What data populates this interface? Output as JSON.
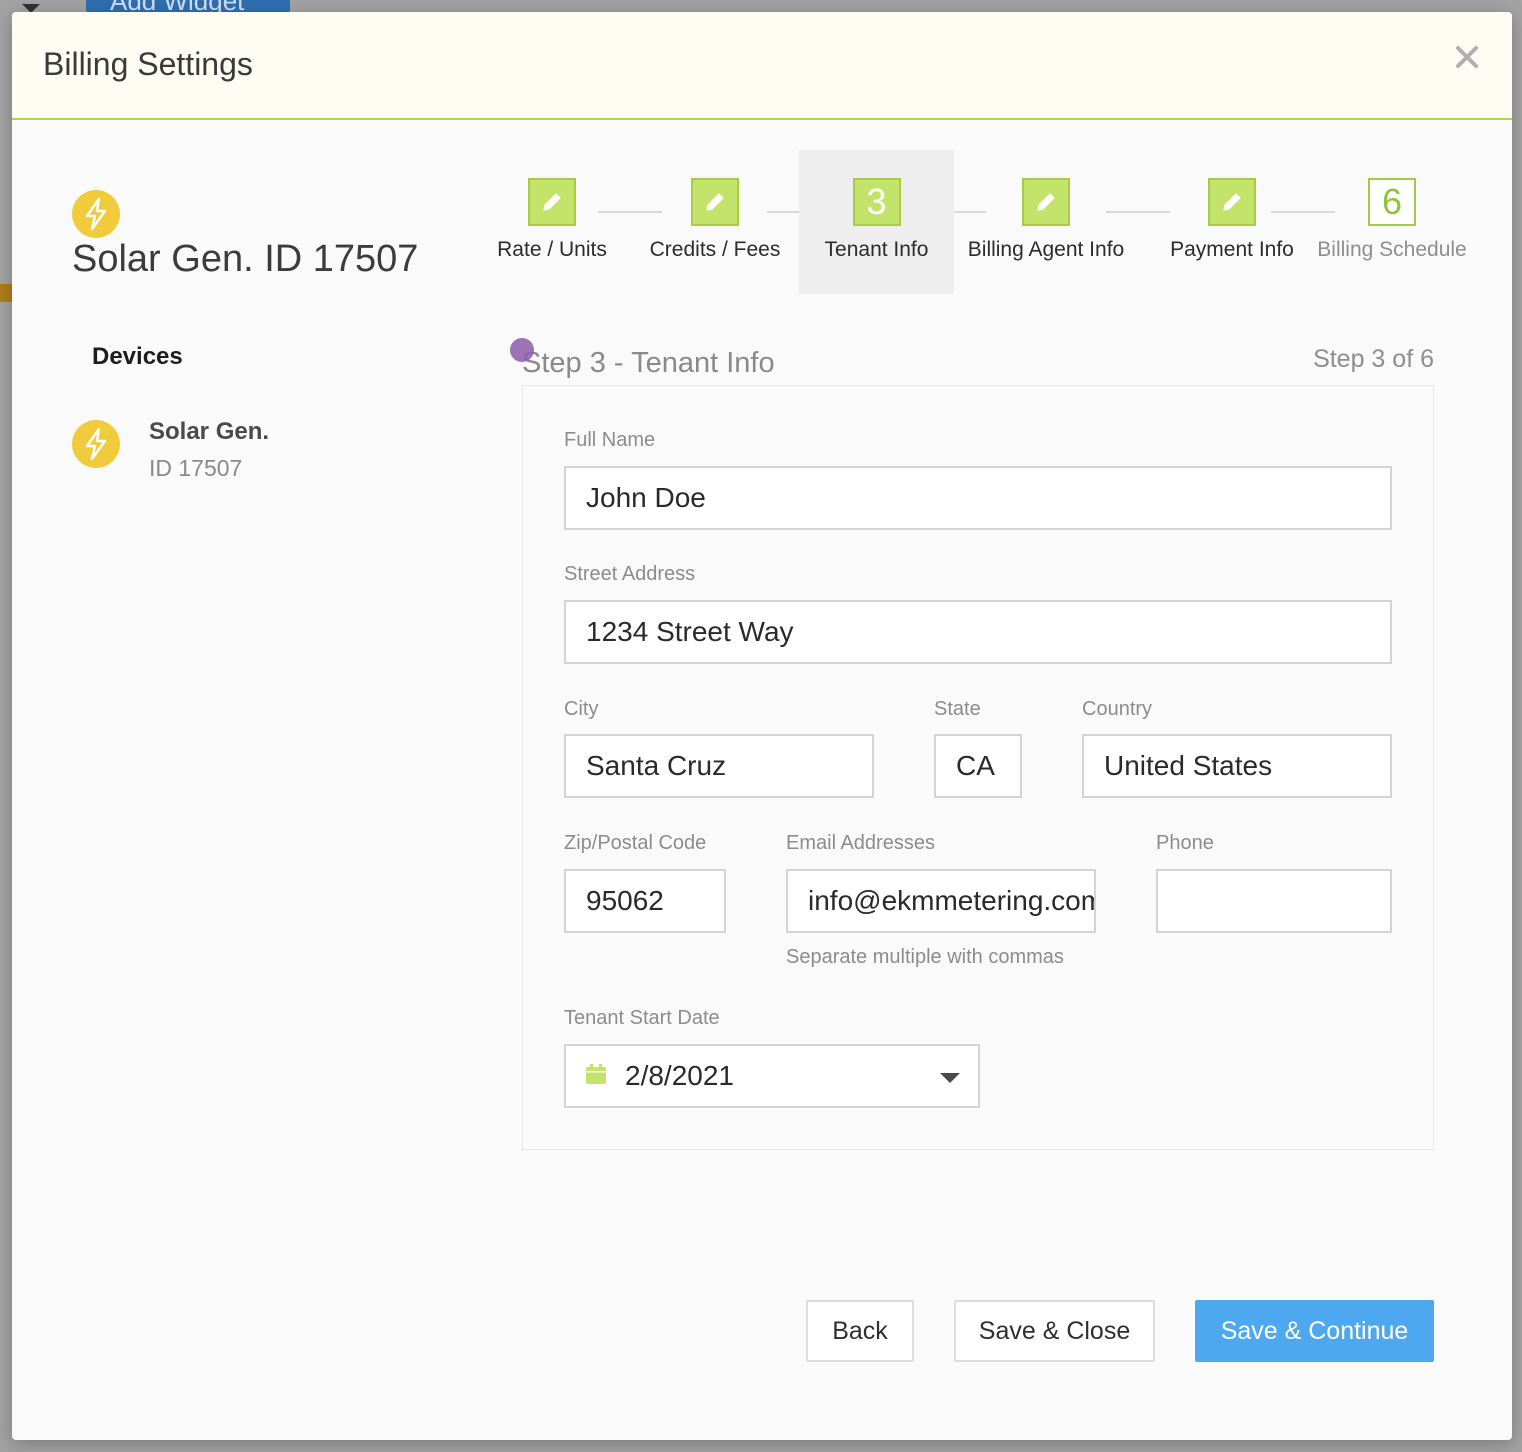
{
  "background": {
    "add_widget_label": "Add Widget"
  },
  "modal": {
    "title": "Billing Settings",
    "close_icon": "close-icon"
  },
  "device_header": {
    "icon": "lightning-bolt-icon",
    "title": "Solar Gen. ID 17507"
  },
  "devices": {
    "heading": "Devices",
    "items": [
      {
        "icon": "lightning-bolt-icon",
        "name": "Solar Gen.",
        "id_label": "ID 17507"
      }
    ]
  },
  "stepper": {
    "steps": [
      {
        "label": "Rate / Units",
        "state": "completed",
        "icon": "pencil-icon"
      },
      {
        "label": "Credits / Fees",
        "state": "completed",
        "icon": "pencil-icon"
      },
      {
        "label": "Tenant Info",
        "state": "active",
        "number": "3"
      },
      {
        "label": "Billing Agent Info",
        "state": "completed",
        "icon": "pencil-icon"
      },
      {
        "label": "Payment Info",
        "state": "completed",
        "icon": "pencil-icon"
      },
      {
        "label": "Billing Schedule",
        "state": "pending",
        "number": "6"
      }
    ]
  },
  "section": {
    "title": "Step 3 - Tenant Info",
    "counter": "Step 3 of 6"
  },
  "form": {
    "full_name": {
      "label": "Full Name",
      "value": "John Doe"
    },
    "street": {
      "label": "Street Address",
      "value": "1234 Street Way"
    },
    "city": {
      "label": "City",
      "value": "Santa Cruz"
    },
    "state": {
      "label": "State",
      "value": "CA"
    },
    "country": {
      "label": "Country",
      "value": "United States"
    },
    "zip": {
      "label": "Zip/Postal Code",
      "value": "95062"
    },
    "email": {
      "label": "Email Addresses",
      "value": "info@ekmmetering.com",
      "help": "Separate multiple with commas"
    },
    "phone": {
      "label": "Phone",
      "value": ""
    },
    "start_date": {
      "label": "Tenant Start Date",
      "value": "2/8/2021",
      "icon": "calendar-icon"
    }
  },
  "buttons": {
    "back": "Back",
    "save_close": "Save & Close",
    "save_continue": "Save & Continue"
  },
  "colors": {
    "accent_green": "#c3e36b",
    "primary_blue": "#4ea8ef",
    "bolt_yellow": "#f0cc3c"
  }
}
